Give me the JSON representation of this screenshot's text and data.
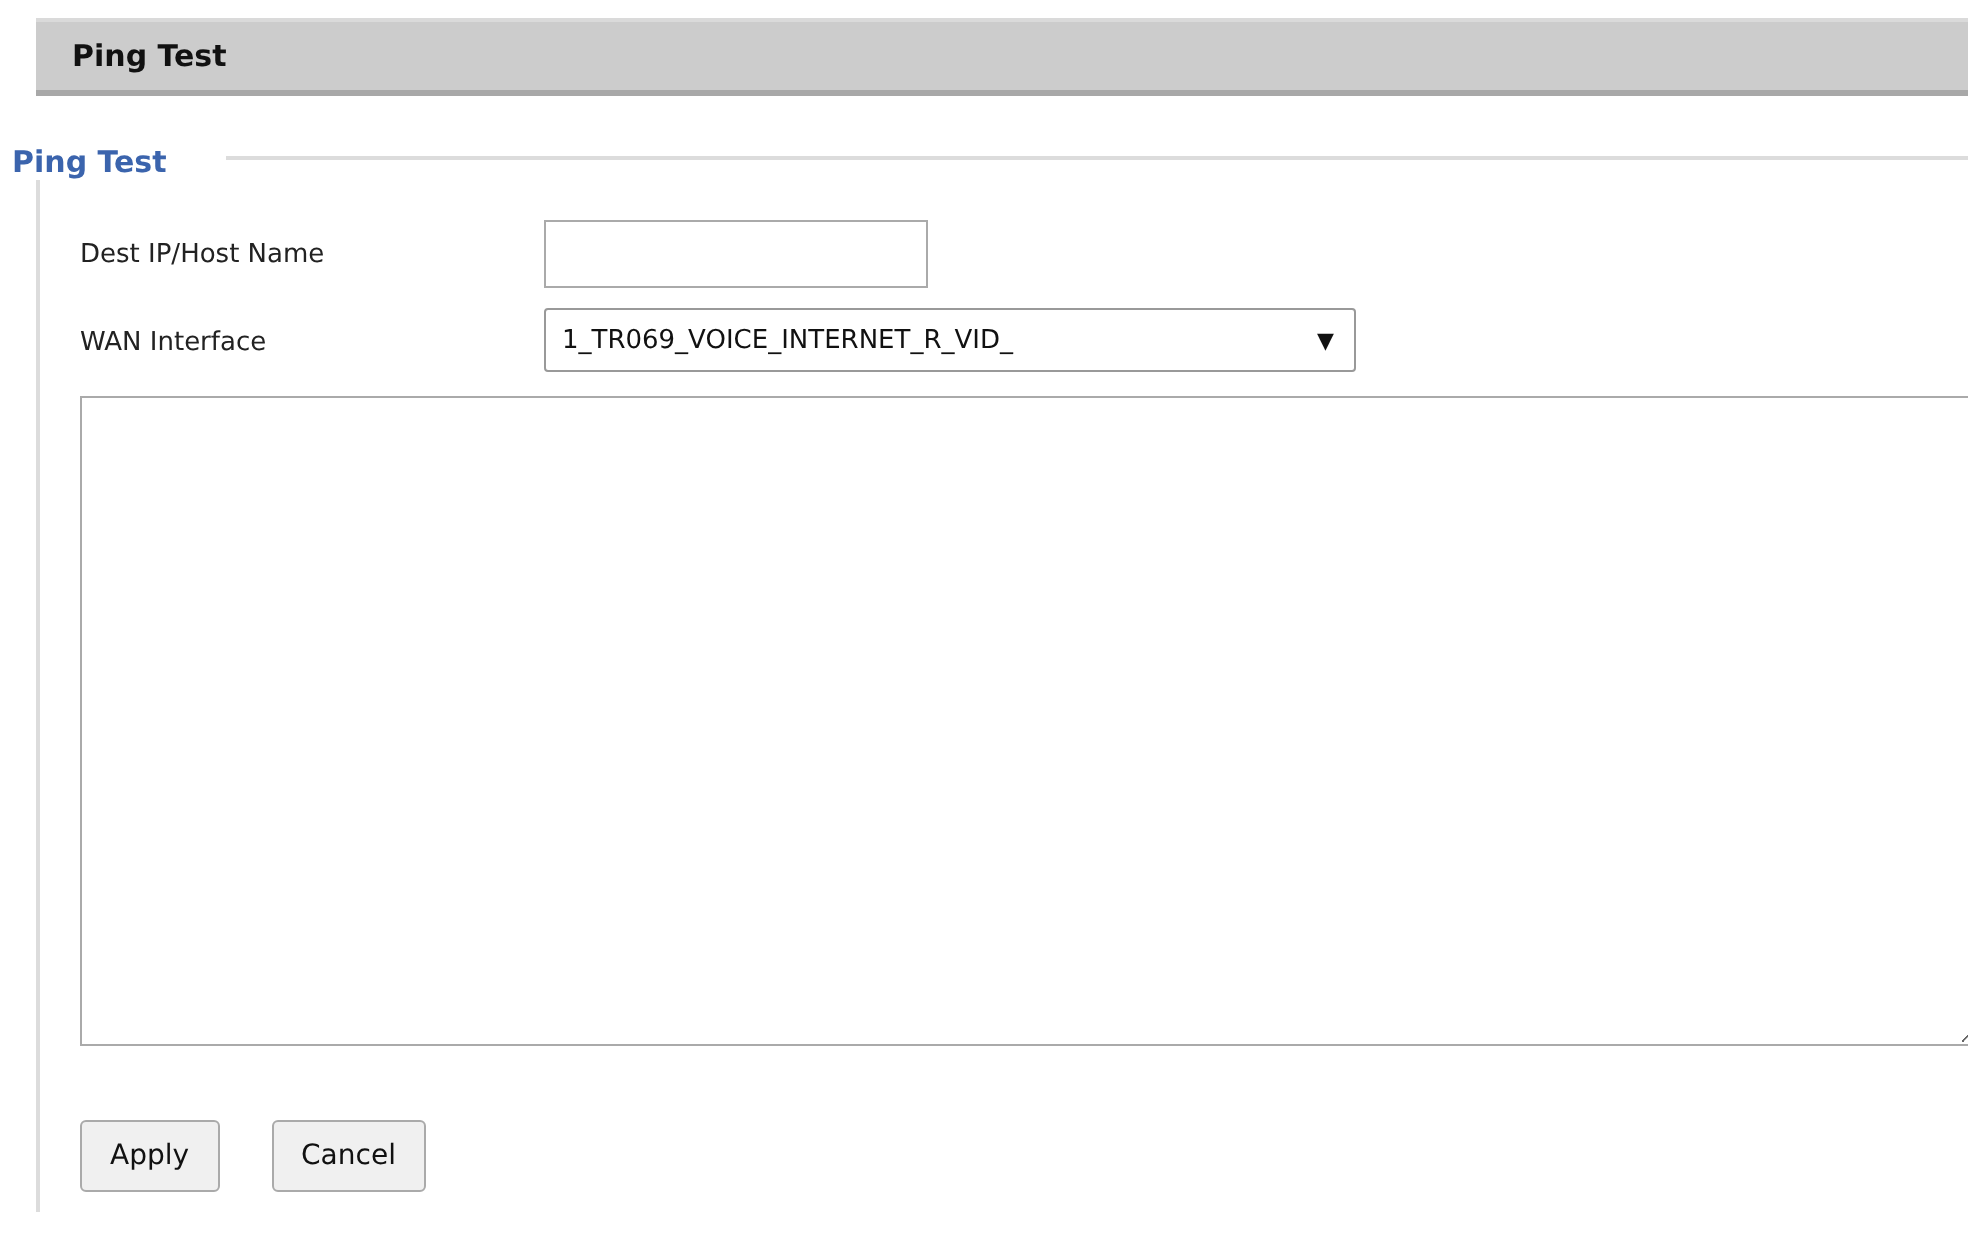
{
  "header": {
    "title": "Ping Test"
  },
  "section": {
    "legend": "Ping Test"
  },
  "fields": [
    {
      "kind": "text",
      "label": "Dest IP/Host Name"
    },
    {
      "kind": "select",
      "label": "WAN Interface",
      "value": "1_TR069_VOICE_INTERNET_R_VID_",
      "arrow": "▼"
    }
  ],
  "buttons": [
    "Apply",
    "Cancel"
  ]
}
